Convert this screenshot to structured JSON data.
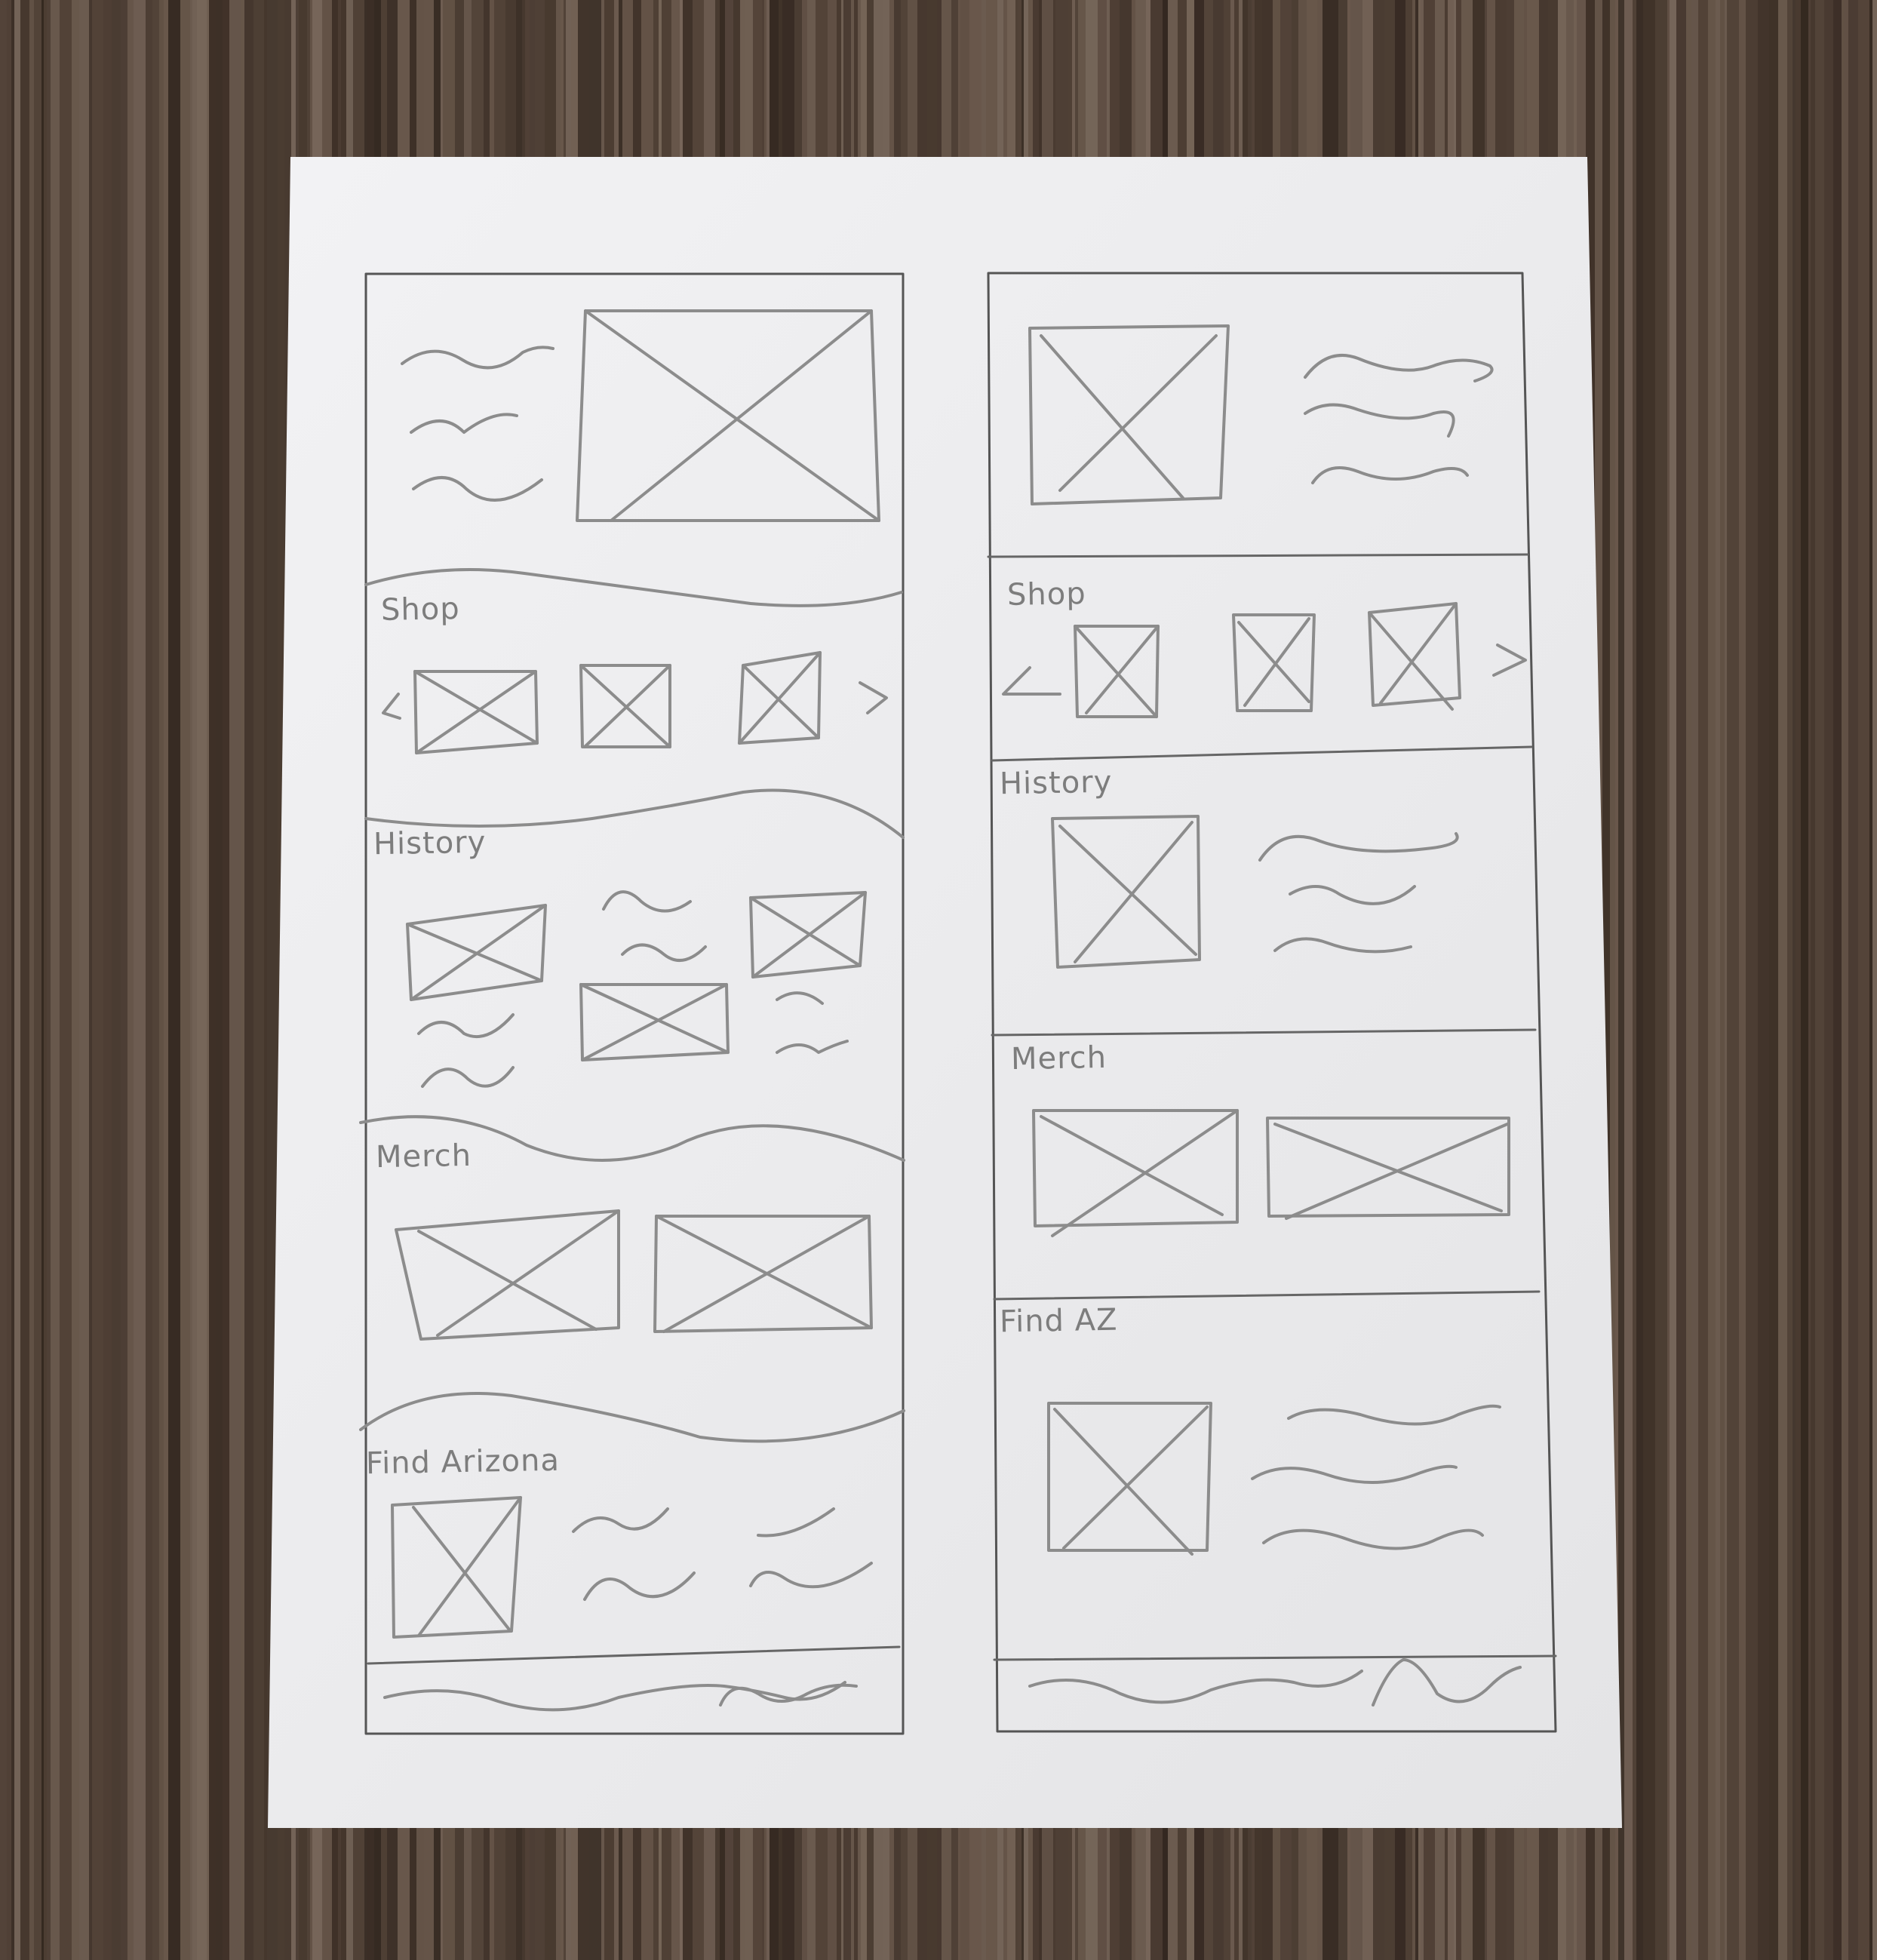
{
  "colors": {
    "wood_dark": "#3a2d24",
    "wood_mid": "#5a4a3f",
    "wood_light": "#7a6a5d",
    "paper": "#ebebed",
    "pencil": "#8a8a8a",
    "frame": "#555555"
  },
  "left_wireframe": {
    "labels": {
      "shop": "Shop",
      "history": "History",
      "merch": "Merch",
      "find": "Find Arizona"
    }
  },
  "right_wireframe": {
    "labels": {
      "shop": "Shop",
      "history": "History",
      "merch": "Merch",
      "find": "Find AZ"
    }
  }
}
